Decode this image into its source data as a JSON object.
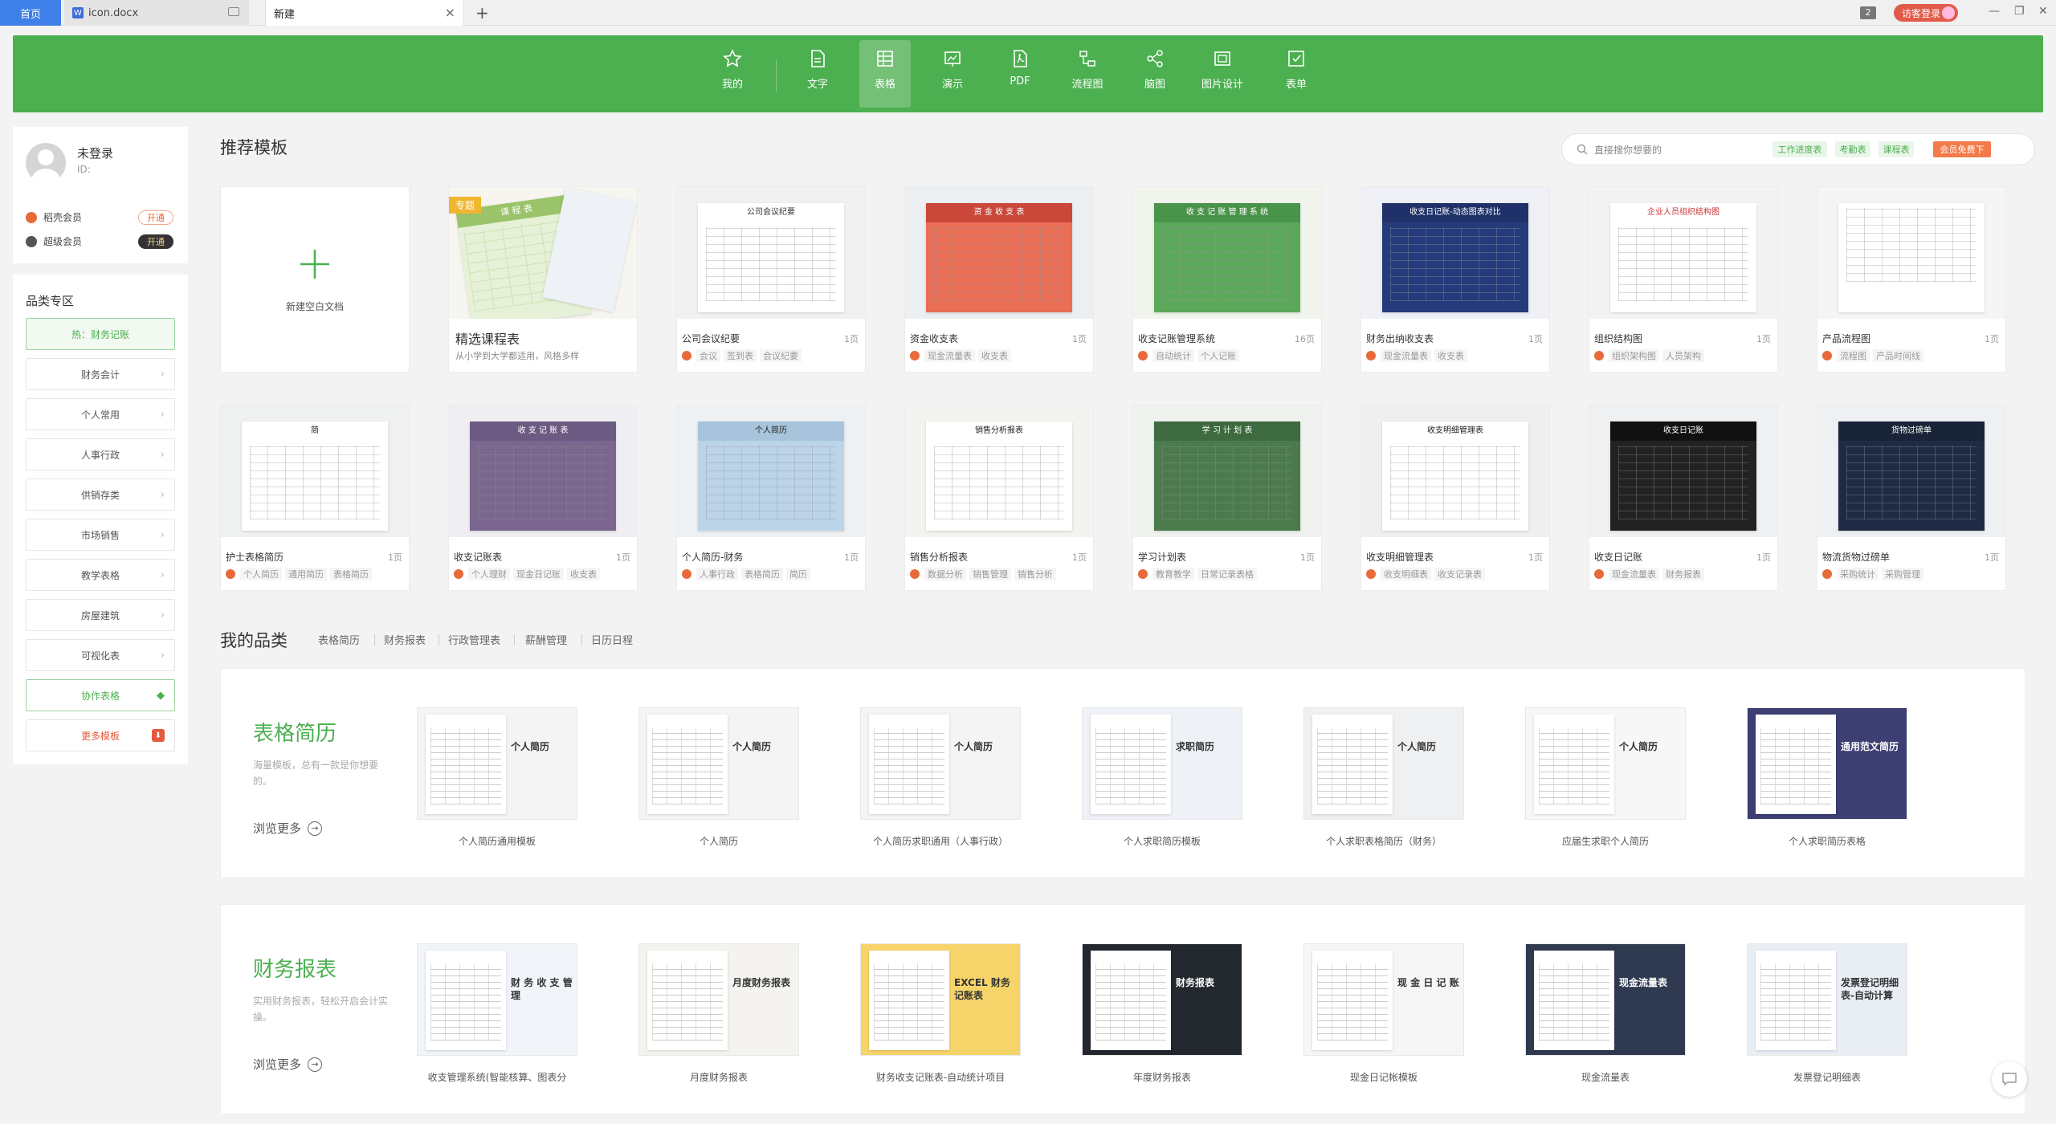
{
  "tabs": {
    "home": "首页",
    "doc": "icon.docx",
    "new": "新建",
    "doc_icon": "W",
    "badge": "2",
    "login": "访客登录"
  },
  "nav": [
    "我的",
    "文字",
    "表格",
    "演示",
    "PDF",
    "流程图",
    "脑图",
    "图片设计",
    "表单"
  ],
  "nav_icons": [
    "star-icon",
    "doc-icon",
    "table-icon",
    "slides-icon",
    "pdf-icon",
    "flowchart-icon",
    "mindmap-icon",
    "image-design-icon",
    "form-icon"
  ],
  "user": {
    "name": "未登录",
    "id": "ID:"
  },
  "membership": [
    {
      "label": "稻壳会员",
      "btn": "开通",
      "color": "#e86a3a"
    },
    {
      "label": "超级会员",
      "btn": "开通",
      "color": "#555555"
    }
  ],
  "categories": {
    "title": "品类专区",
    "items": [
      "热：财务记账",
      "财务会计",
      "个人常用",
      "人事行政",
      "供销存类",
      "市场销售",
      "教学表格",
      "房屋建筑",
      "可视化表",
      "协作表格",
      "更多模板"
    ]
  },
  "recommend": {
    "title": "推荐模板",
    "search_placeholder": "直接搜你想要的",
    "chips": [
      "工作进度表",
      "考勤表",
      "课程表",
      "会员免费下"
    ],
    "blank_label": "新建空白文档",
    "special": {
      "badge": "专题",
      "name": "精选课程表",
      "desc": "从小学到大学都适用，风格多样"
    }
  },
  "templates": [
    {
      "name": "公司会议纪要",
      "pages": "1页",
      "tags": [
        "会议",
        "签到表",
        "会议纪要"
      ]
    },
    {
      "name": "资金收支表",
      "pages": "1页",
      "tags": [
        "现金流量表",
        "收支表"
      ]
    },
    {
      "name": "收支记账管理系统",
      "pages": "16页",
      "tags": [
        "自动统计",
        "个人记账"
      ]
    },
    {
      "name": "财务出纳收支表",
      "pages": "1页",
      "tags": [
        "现金流量表",
        "收支表"
      ]
    },
    {
      "name": "组织结构图",
      "pages": "1页",
      "tags": [
        "组织架构图",
        "人员架构"
      ]
    },
    {
      "name": "产品流程图",
      "pages": "1页",
      "tags": [
        "流程图",
        "产品时间线"
      ]
    },
    {
      "name": "护士表格简历",
      "pages": "1页",
      "tags": [
        "个人简历",
        "通用简历",
        "表格简历"
      ]
    },
    {
      "name": "收支记账表",
      "pages": "1页",
      "tags": [
        "个人理财",
        "现金日记账",
        "收支表"
      ]
    },
    {
      "name": "个人简历-财务",
      "pages": "1页",
      "tags": [
        "人事行政",
        "表格简历",
        "简历"
      ]
    },
    {
      "name": "销售分析报表",
      "pages": "1页",
      "tags": [
        "数据分析",
        "销售管理",
        "销售分析"
      ]
    },
    {
      "name": "学习计划表",
      "pages": "1页",
      "tags": [
        "教育教学",
        "日常记录表格"
      ]
    },
    {
      "name": "收支明细管理表",
      "pages": "1页",
      "tags": [
        "收支明细表",
        "收支记录表"
      ]
    },
    {
      "name": "收支日记账",
      "pages": "1页",
      "tags": [
        "现金流量表",
        "财务报表"
      ]
    },
    {
      "name": "物流货物过磅单",
      "pages": "1页",
      "tags": [
        "采购统计",
        "采购管理"
      ]
    }
  ],
  "thumb_texts": {
    "meeting": "公司会议纪要",
    "fund": "资 金 收 支 表",
    "system": "收 支 记 账 管 理 系 统",
    "finance": "收支日记账-动态图表对比",
    "org": "企业人员组织结构图",
    "resume": "简\n历",
    "ledger": "收 支 记 账 表",
    "resume2": "个人简历",
    "sales": "销售分析报表",
    "study": "学 习 计 划 表",
    "detail": "收支明细管理表",
    "daily": "收支日记账",
    "weigh": "货物过磅单",
    "course": "课 程 表"
  },
  "mycat": {
    "title": "我的品类",
    "tabs": [
      "表格简历",
      "财务报表",
      "行政管理表",
      "薪酬管理",
      "日历日程"
    ]
  },
  "rows": [
    {
      "title": "表格简历",
      "desc": "海量模板，总有一款是你想要的。",
      "more": "浏览更多",
      "items": [
        "个人简历通用模板",
        "个人简历",
        "个人简历求职通用（人事行政）",
        "个人求职简历模板",
        "个人求职表格简历（财务）",
        "应届生求职个人简历",
        "个人求职简历表格"
      ],
      "thumb_texts": [
        "个人简历",
        "个人简历",
        "个人简历",
        "求职简历",
        "个人简历",
        "个人简历",
        "通用范文简历"
      ]
    },
    {
      "title": "财务报表",
      "desc": "实用财务报表，轻松开启会计实操。",
      "more": "浏览更多",
      "items": [
        "收支管理系统(智能核算、图表分",
        "月度财务报表",
        "财务收支记账表-自动统计项目",
        "年度财务报表",
        "现金日记帐模板",
        "现金流量表",
        "发票登记明细表"
      ],
      "thumb_texts": [
        "财 务 收 支 管 理",
        "月度财务报表",
        "EXCEL 财务记账表",
        "财务报表",
        "现 金 日 记 账",
        "现金流量表",
        "发票登记明细表-自动计算"
      ]
    }
  ]
}
